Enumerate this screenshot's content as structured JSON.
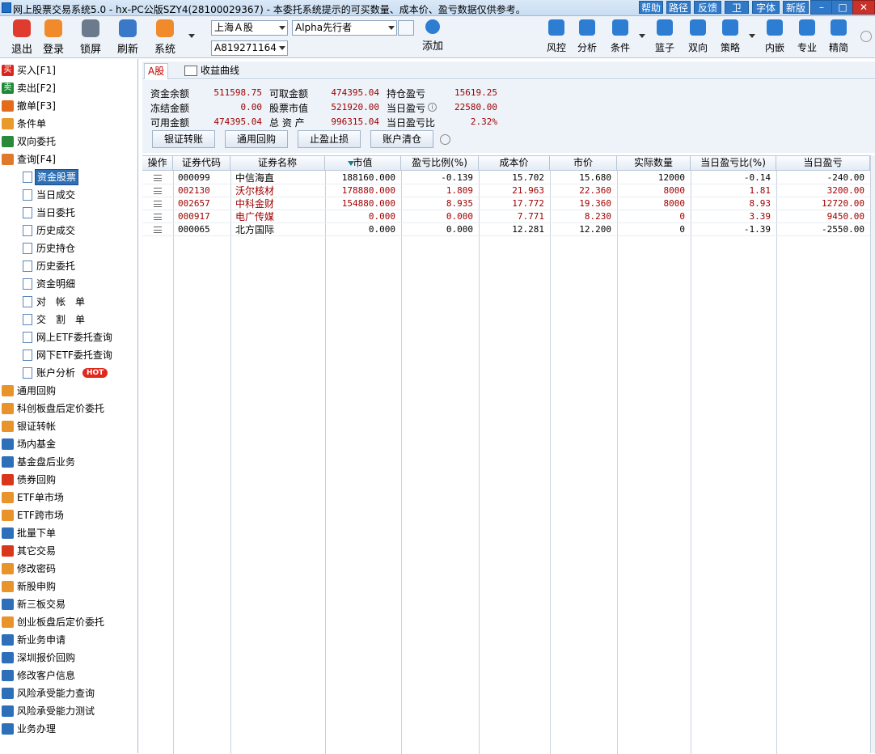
{
  "window": {
    "title": "网上股票交易系统5.0 - hx-PC公版SZY4(28100029367) - 本委托系统提示的可买数量、成本价、盈亏数据仅供参考。",
    "menu_buttons": [
      "帮助",
      "路径",
      "反馈",
      "卫",
      "字体",
      "新版"
    ],
    "controls": {
      "minimize": "–",
      "maximize": "□",
      "close": "✕"
    }
  },
  "toolbar": {
    "left_tools": [
      {
        "label": "退出",
        "icon": "power-icon",
        "color": "#e03b2f"
      },
      {
        "label": "登录",
        "icon": "user-icon",
        "color": "#f08a2a"
      },
      {
        "label": "锁屏",
        "icon": "lock-icon",
        "color": "#6b7a8c"
      },
      {
        "label": "刷新",
        "icon": "refresh-icon",
        "color": "#3a78c8"
      },
      {
        "label": "系统",
        "icon": "tools-icon",
        "color": "#f08a2a"
      }
    ],
    "market_select": "上海Ａ股",
    "account_select": "A819271164",
    "strategy_select": "Alpha先行者",
    "add_label": "添加",
    "right_tools": [
      {
        "label": "风控",
        "icon": "shield-icon",
        "color": "#2d7dd2"
      },
      {
        "label": "分析",
        "icon": "analysis-icon",
        "color": "#2d7dd2"
      },
      {
        "label": "条件",
        "icon": "condition-icon",
        "color": "#2d7dd2"
      },
      {
        "label": "篮子",
        "icon": "basket-icon",
        "color": "#2d7dd2"
      },
      {
        "label": "双向",
        "icon": "bidirection-icon",
        "color": "#2d7dd2"
      },
      {
        "label": "策略",
        "icon": "strategy-icon",
        "color": "#2d7dd2"
      },
      {
        "label": "内嵌",
        "icon": "embed-icon",
        "color": "#2d7dd2"
      },
      {
        "label": "专业",
        "icon": "pro-icon",
        "color": "#2d7dd2"
      },
      {
        "label": "精简",
        "icon": "simple-icon",
        "color": "#2d7dd2"
      }
    ]
  },
  "sidebar": {
    "top_items": [
      {
        "label": "买入[F1]",
        "icon": "buy-icon",
        "color": "#d9261c",
        "glyph": "买"
      },
      {
        "label": "卖出[F2]",
        "icon": "sell-icon",
        "color": "#1f8a3a",
        "glyph": "卖"
      },
      {
        "label": "撤单[F3]",
        "icon": "cancel-order-icon",
        "color": "#e36b1a",
        "glyph": ""
      },
      {
        "label": "条件单",
        "icon": "condition-order-icon",
        "color": "#e89a2a",
        "glyph": ""
      },
      {
        "label": "双向委托",
        "icon": "bidirection-order-icon",
        "color": "#2a8a3a",
        "glyph": ""
      },
      {
        "label": "查询[F4]",
        "icon": "query-icon",
        "color": "#e07a2a",
        "glyph": ""
      }
    ],
    "query_items": [
      {
        "label": "资金股票",
        "selected": true
      },
      {
        "label": "当日成交"
      },
      {
        "label": "当日委托"
      },
      {
        "label": "历史成交"
      },
      {
        "label": "历史持仓"
      },
      {
        "label": "历史委托"
      },
      {
        "label": "资金明细"
      },
      {
        "label": "对　帐　单"
      },
      {
        "label": "交　割　单"
      },
      {
        "label": "网上ETF委托查询"
      },
      {
        "label": "网下ETF委托查询"
      },
      {
        "label": "账户分析",
        "badge": "HOT"
      }
    ],
    "bottom_items": [
      {
        "label": "通用回购",
        "icon": "repo-icon",
        "color": "#e8942a"
      },
      {
        "label": "科创板盘后定价委托",
        "icon": "star-market-icon",
        "color": "#e8942a"
      },
      {
        "label": "银证转帐",
        "icon": "bank-transfer-icon",
        "color": "#e8942a"
      },
      {
        "label": "场内基金",
        "icon": "fund-icon",
        "color": "#2d6fb8"
      },
      {
        "label": "基金盘后业务",
        "icon": "fund-after-icon",
        "color": "#2d6fb8"
      },
      {
        "label": "债券回购",
        "icon": "bond-repo-icon",
        "color": "#d9361c"
      },
      {
        "label": "ETF单市场",
        "icon": "etf-single-icon",
        "color": "#e8942a"
      },
      {
        "label": "ETF跨市场",
        "icon": "etf-cross-icon",
        "color": "#e8942a"
      },
      {
        "label": "批量下单",
        "icon": "batch-order-icon",
        "color": "#2d6fb8"
      },
      {
        "label": "其它交易",
        "icon": "other-trade-icon",
        "color": "#d9361c"
      },
      {
        "label": "修改密码",
        "icon": "key-icon",
        "color": "#e8942a"
      },
      {
        "label": "新股申购",
        "icon": "ipo-icon",
        "color": "#e8942a"
      },
      {
        "label": "新三板交易",
        "icon": "neeq-icon",
        "color": "#2d6fb8"
      },
      {
        "label": "创业板盘后定价委托",
        "icon": "gem-after-icon",
        "color": "#e8942a"
      },
      {
        "label": "新业务申请",
        "icon": "new-business-icon",
        "color": "#2d6fb8"
      },
      {
        "label": "深圳报价回购",
        "icon": "sz-repo-icon",
        "color": "#2d6fb8"
      },
      {
        "label": "修改客户信息",
        "icon": "edit-client-icon",
        "color": "#2d6fb8"
      },
      {
        "label": "风险承受能力查询",
        "icon": "risk-query-icon",
        "color": "#2d6fb8"
      },
      {
        "label": "风险承受能力测试",
        "icon": "risk-test-icon",
        "color": "#2d6fb8"
      },
      {
        "label": "业务办理",
        "icon": "business-icon",
        "color": "#2d6fb8"
      }
    ]
  },
  "main": {
    "tabs": [
      {
        "label": "A股"
      },
      {
        "label": "收益曲线"
      }
    ],
    "summary": {
      "balance_label": "资金余额",
      "balance": "511598.75",
      "withdrawable_label": "可取金额",
      "withdrawable": "474395.04",
      "position_pnl_label": "持仓盈亏",
      "position_pnl": "15619.25",
      "frozen_label": "冻结金额",
      "frozen": "0.00",
      "stock_value_label": "股票市值",
      "stock_value": "521920.00",
      "today_pnl_label": "当日盈亏",
      "today_pnl": "22580.00",
      "available_label": "可用金额",
      "available": "474395.04",
      "total_assets_label": "总 资 产",
      "total_assets": "996315.04",
      "today_pnl_ratio_label": "当日盈亏比",
      "today_pnl_ratio": "2.32%"
    },
    "actions": [
      "银证转账",
      "通用回购",
      "止盈止损",
      "账户清仓"
    ],
    "table": {
      "columns": [
        "操作",
        "证券代码",
        "证券名称",
        "市值",
        "盈亏比例(%)",
        "成本价",
        "市价",
        "实际数量",
        "当日盈亏比(%)",
        "当日盈亏"
      ],
      "rows": [
        [
          "000099",
          "中信海直",
          "188160.000",
          "-0.139",
          "15.702",
          "15.680",
          "12000",
          "-0.14",
          "-240.00"
        ],
        [
          "002130",
          "沃尔核材",
          "178880.000",
          "1.809",
          "21.963",
          "22.360",
          "8000",
          "1.81",
          "3200.00"
        ],
        [
          "002657",
          "中科金财",
          "154880.000",
          "8.935",
          "17.772",
          "19.360",
          "8000",
          "8.93",
          "12720.00"
        ],
        [
          "000917",
          "电广传媒",
          "0.000",
          "0.000",
          "7.771",
          "8.230",
          "0",
          "3.39",
          "9450.00"
        ],
        [
          "000065",
          "北方国际",
          "0.000",
          "0.000",
          "12.281",
          "12.200",
          "0",
          "-1.39",
          "-2550.00"
        ]
      ],
      "row_colors": [
        "#000000",
        "#a00000",
        "#a00000",
        "#a00000",
        "#000000"
      ]
    }
  }
}
